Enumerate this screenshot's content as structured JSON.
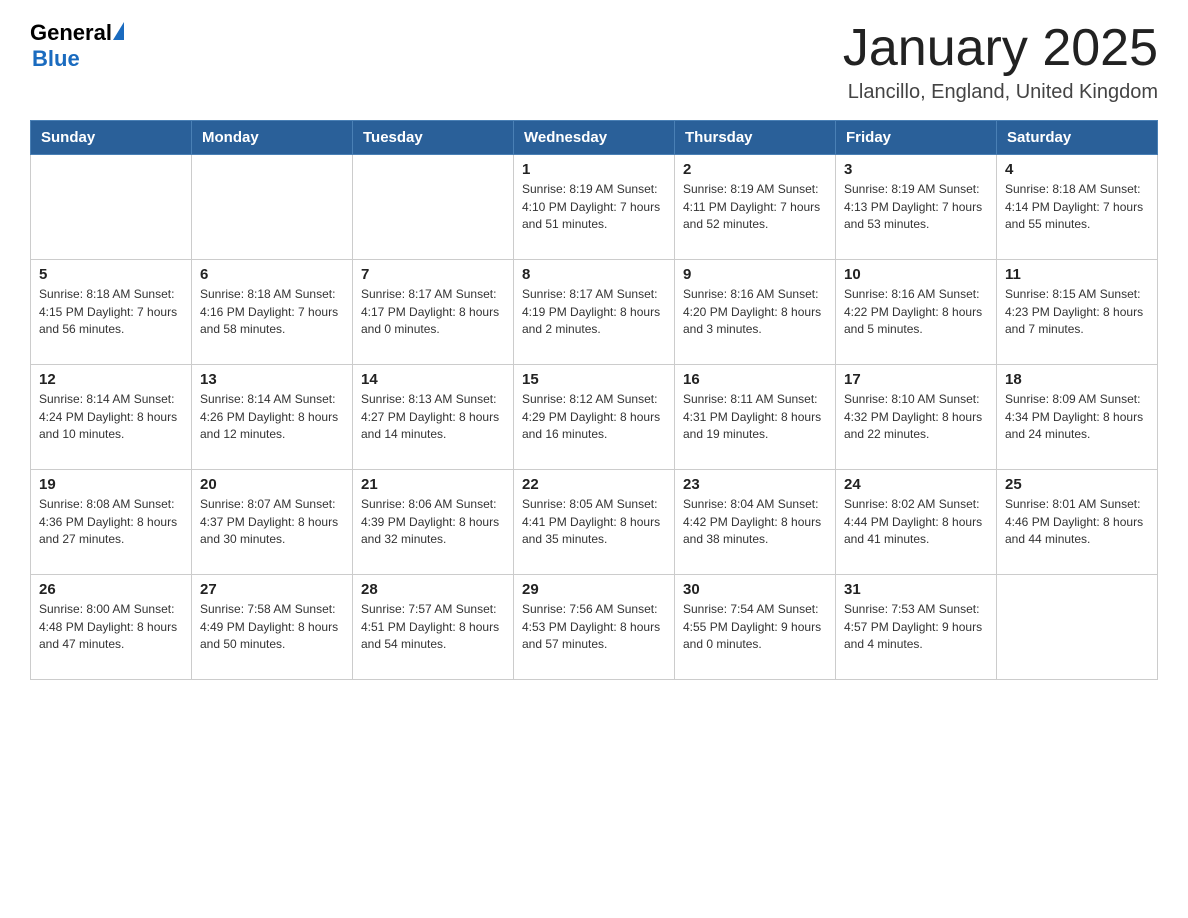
{
  "header": {
    "title": "January 2025",
    "location": "Llancillo, England, United Kingdom",
    "logo": {
      "general": "General",
      "blue": "Blue"
    }
  },
  "calendar": {
    "days_of_week": [
      "Sunday",
      "Monday",
      "Tuesday",
      "Wednesday",
      "Thursday",
      "Friday",
      "Saturday"
    ],
    "weeks": [
      [
        {
          "day": "",
          "info": ""
        },
        {
          "day": "",
          "info": ""
        },
        {
          "day": "",
          "info": ""
        },
        {
          "day": "1",
          "info": "Sunrise: 8:19 AM\nSunset: 4:10 PM\nDaylight: 7 hours\nand 51 minutes."
        },
        {
          "day": "2",
          "info": "Sunrise: 8:19 AM\nSunset: 4:11 PM\nDaylight: 7 hours\nand 52 minutes."
        },
        {
          "day": "3",
          "info": "Sunrise: 8:19 AM\nSunset: 4:13 PM\nDaylight: 7 hours\nand 53 minutes."
        },
        {
          "day": "4",
          "info": "Sunrise: 8:18 AM\nSunset: 4:14 PM\nDaylight: 7 hours\nand 55 minutes."
        }
      ],
      [
        {
          "day": "5",
          "info": "Sunrise: 8:18 AM\nSunset: 4:15 PM\nDaylight: 7 hours\nand 56 minutes."
        },
        {
          "day": "6",
          "info": "Sunrise: 8:18 AM\nSunset: 4:16 PM\nDaylight: 7 hours\nand 58 minutes."
        },
        {
          "day": "7",
          "info": "Sunrise: 8:17 AM\nSunset: 4:17 PM\nDaylight: 8 hours\nand 0 minutes."
        },
        {
          "day": "8",
          "info": "Sunrise: 8:17 AM\nSunset: 4:19 PM\nDaylight: 8 hours\nand 2 minutes."
        },
        {
          "day": "9",
          "info": "Sunrise: 8:16 AM\nSunset: 4:20 PM\nDaylight: 8 hours\nand 3 minutes."
        },
        {
          "day": "10",
          "info": "Sunrise: 8:16 AM\nSunset: 4:22 PM\nDaylight: 8 hours\nand 5 minutes."
        },
        {
          "day": "11",
          "info": "Sunrise: 8:15 AM\nSunset: 4:23 PM\nDaylight: 8 hours\nand 7 minutes."
        }
      ],
      [
        {
          "day": "12",
          "info": "Sunrise: 8:14 AM\nSunset: 4:24 PM\nDaylight: 8 hours\nand 10 minutes."
        },
        {
          "day": "13",
          "info": "Sunrise: 8:14 AM\nSunset: 4:26 PM\nDaylight: 8 hours\nand 12 minutes."
        },
        {
          "day": "14",
          "info": "Sunrise: 8:13 AM\nSunset: 4:27 PM\nDaylight: 8 hours\nand 14 minutes."
        },
        {
          "day": "15",
          "info": "Sunrise: 8:12 AM\nSunset: 4:29 PM\nDaylight: 8 hours\nand 16 minutes."
        },
        {
          "day": "16",
          "info": "Sunrise: 8:11 AM\nSunset: 4:31 PM\nDaylight: 8 hours\nand 19 minutes."
        },
        {
          "day": "17",
          "info": "Sunrise: 8:10 AM\nSunset: 4:32 PM\nDaylight: 8 hours\nand 22 minutes."
        },
        {
          "day": "18",
          "info": "Sunrise: 8:09 AM\nSunset: 4:34 PM\nDaylight: 8 hours\nand 24 minutes."
        }
      ],
      [
        {
          "day": "19",
          "info": "Sunrise: 8:08 AM\nSunset: 4:36 PM\nDaylight: 8 hours\nand 27 minutes."
        },
        {
          "day": "20",
          "info": "Sunrise: 8:07 AM\nSunset: 4:37 PM\nDaylight: 8 hours\nand 30 minutes."
        },
        {
          "day": "21",
          "info": "Sunrise: 8:06 AM\nSunset: 4:39 PM\nDaylight: 8 hours\nand 32 minutes."
        },
        {
          "day": "22",
          "info": "Sunrise: 8:05 AM\nSunset: 4:41 PM\nDaylight: 8 hours\nand 35 minutes."
        },
        {
          "day": "23",
          "info": "Sunrise: 8:04 AM\nSunset: 4:42 PM\nDaylight: 8 hours\nand 38 minutes."
        },
        {
          "day": "24",
          "info": "Sunrise: 8:02 AM\nSunset: 4:44 PM\nDaylight: 8 hours\nand 41 minutes."
        },
        {
          "day": "25",
          "info": "Sunrise: 8:01 AM\nSunset: 4:46 PM\nDaylight: 8 hours\nand 44 minutes."
        }
      ],
      [
        {
          "day": "26",
          "info": "Sunrise: 8:00 AM\nSunset: 4:48 PM\nDaylight: 8 hours\nand 47 minutes."
        },
        {
          "day": "27",
          "info": "Sunrise: 7:58 AM\nSunset: 4:49 PM\nDaylight: 8 hours\nand 50 minutes."
        },
        {
          "day": "28",
          "info": "Sunrise: 7:57 AM\nSunset: 4:51 PM\nDaylight: 8 hours\nand 54 minutes."
        },
        {
          "day": "29",
          "info": "Sunrise: 7:56 AM\nSunset: 4:53 PM\nDaylight: 8 hours\nand 57 minutes."
        },
        {
          "day": "30",
          "info": "Sunrise: 7:54 AM\nSunset: 4:55 PM\nDaylight: 9 hours\nand 0 minutes."
        },
        {
          "day": "31",
          "info": "Sunrise: 7:53 AM\nSunset: 4:57 PM\nDaylight: 9 hours\nand 4 minutes."
        },
        {
          "day": "",
          "info": ""
        }
      ]
    ]
  }
}
